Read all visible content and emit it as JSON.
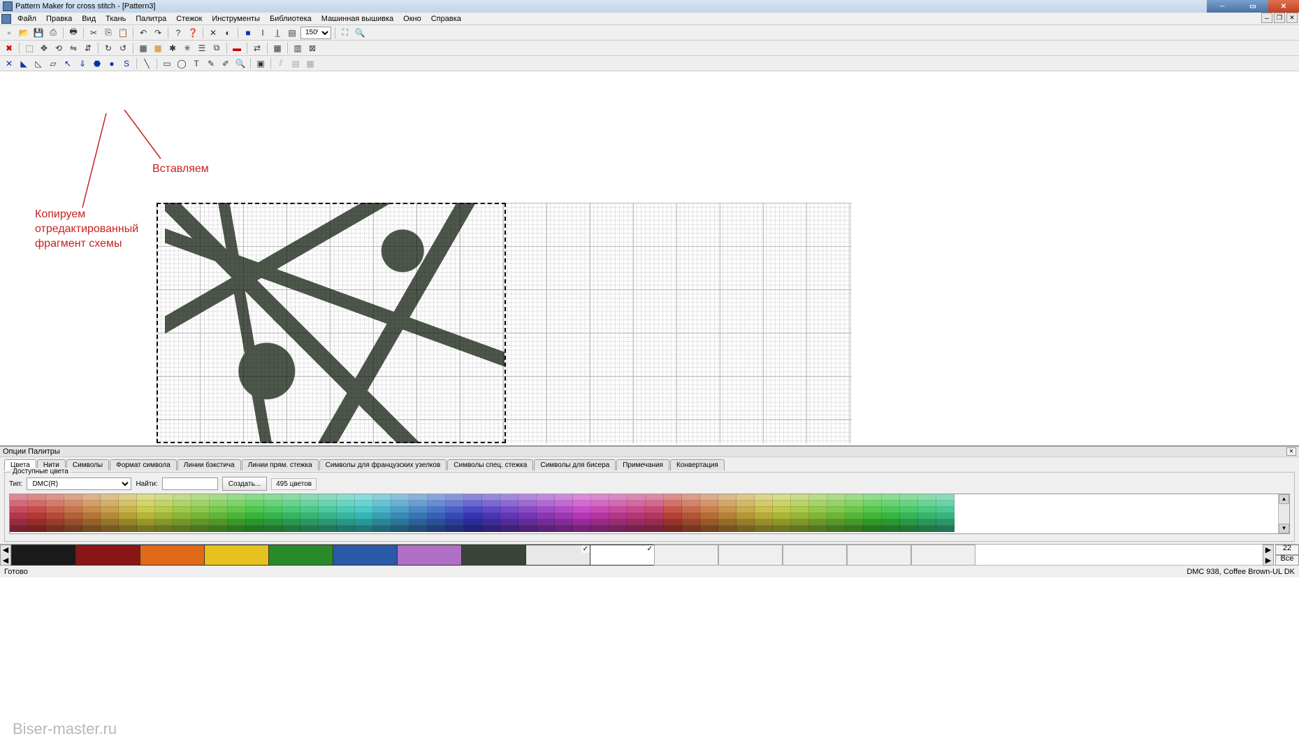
{
  "title": "Pattern Maker for cross stitch - [Pattern3]",
  "menu": [
    "Файл",
    "Правка",
    "Вид",
    "Ткань",
    "Палитра",
    "Стежок",
    "Инструменты",
    "Библиотека",
    "Машинная вышивка",
    "Окно",
    "Справка"
  ],
  "zoom": "150%",
  "annotations": {
    "paste": "Вставляем",
    "copy": "Копируем отредактированный фрагмент схемы"
  },
  "palettePanel": {
    "title": "Опции Палитры",
    "tabs": [
      "Цвета",
      "Нити",
      "Символы",
      "Формат символа",
      "Линии бэкстича",
      "Линии прям. стежка",
      "Символы для французских узелков",
      "Символы спец. стежка",
      "Символы для бисера",
      "Примечания",
      "Конвертация"
    ],
    "group": "Доступные цвета",
    "typeLabel": "Тип:",
    "typeValue": "DMC(R)",
    "findLabel": "Найти:",
    "findValue": "",
    "createBtn": "Создать...",
    "count": "495 цветов"
  },
  "bigPalette": [
    {
      "c": "#1a1a1a"
    },
    {
      "c": "#8a1616"
    },
    {
      "c": "#e06a1a"
    },
    {
      "c": "#e6c120"
    },
    {
      "c": "#2a8a2a"
    },
    {
      "c": "#2a5aa8"
    },
    {
      "c": "#b070c8"
    },
    {
      "c": "#3a4538"
    },
    {
      "c": "#e8e8e8",
      "check": true
    },
    {
      "c": "#ffffff",
      "check": true
    },
    {
      "c": "",
      "e": true
    },
    {
      "c": "",
      "e": true
    },
    {
      "c": "",
      "e": true
    },
    {
      "c": "",
      "e": true
    },
    {
      "c": "",
      "e": true
    }
  ],
  "sideLabels": {
    "count": "22",
    "all": "Все"
  },
  "status": {
    "left": "Готово",
    "right": "DMC  938, Coffee Brown-UL DK"
  },
  "watermark": "Biser-master.ru",
  "swatchHues": [
    350,
    0,
    10,
    20,
    30,
    40,
    50,
    60,
    70,
    80,
    90,
    100,
    110,
    120,
    130,
    140,
    150,
    160,
    170,
    180,
    190,
    200,
    210,
    220,
    230,
    240,
    250,
    260,
    270,
    280,
    290,
    300,
    310,
    320,
    330,
    340,
    5,
    15,
    25,
    35,
    45,
    55,
    65,
    75,
    85,
    95,
    105,
    115,
    125,
    135,
    145,
    155
  ]
}
